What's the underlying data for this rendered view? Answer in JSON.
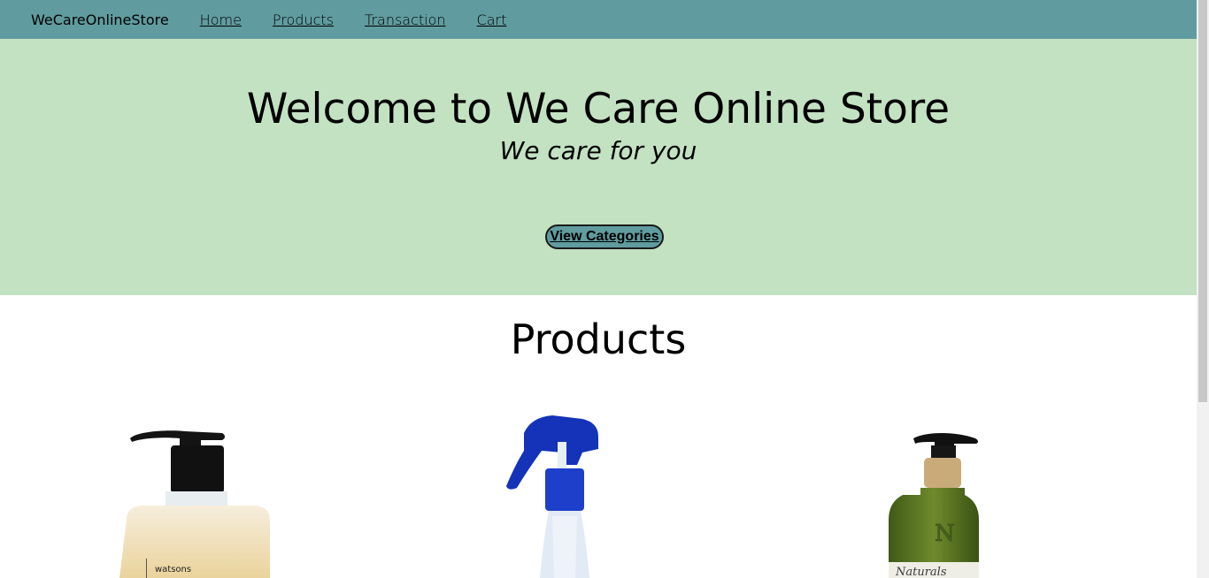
{
  "nav": {
    "brand": "WeCareOnlineStore",
    "links": [
      "Home",
      "Products",
      "Transaction",
      "Cart"
    ]
  },
  "hero": {
    "title": "Welcome to We Care Online Store",
    "subtitle": "We care for you",
    "button_label": "View Categories"
  },
  "products_section": {
    "title": "Products",
    "items": [
      {
        "icon": "soap-pump-bottle-icon",
        "label_text": "watsons"
      },
      {
        "icon": "spray-bottle-icon"
      },
      {
        "icon": "green-pump-bottle-icon",
        "label_text": "Naturals"
      }
    ]
  },
  "colors": {
    "navbar": "#609c9f",
    "hero_bg": "#c3e2c2",
    "button_bg": "#609c9f"
  }
}
